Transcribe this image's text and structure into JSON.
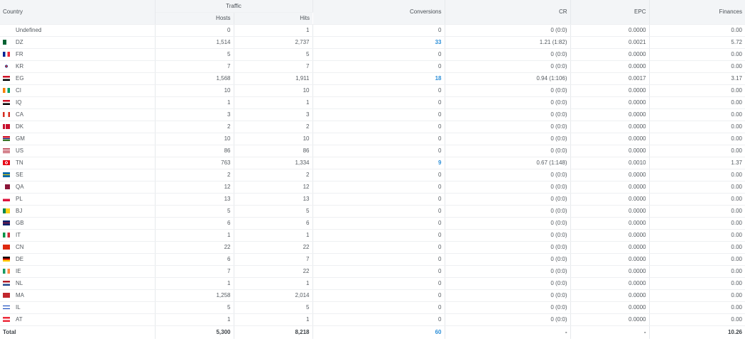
{
  "headers": {
    "country": "Country",
    "traffic": "Traffic",
    "hosts": "Hosts",
    "hits": "Hits",
    "conversions": "Conversions",
    "cr": "CR",
    "epc": "EPC",
    "finances": "Finances"
  },
  "rows": [
    {
      "country": "Undefined",
      "flag": "none",
      "hosts": "0",
      "hits": "1",
      "conversions": "0",
      "conv_link": false,
      "cr": "0 (0:0)",
      "epc": "0.0000",
      "finances": "0.00"
    },
    {
      "country": "DZ",
      "flag": "dz",
      "hosts": "1,514",
      "hits": "2,737",
      "conversions": "33",
      "conv_link": true,
      "cr": "1.21 (1:82)",
      "epc": "0.0021",
      "finances": "5.72"
    },
    {
      "country": "FR",
      "flag": "fr",
      "hosts": "5",
      "hits": "5",
      "conversions": "0",
      "conv_link": false,
      "cr": "0 (0:0)",
      "epc": "0.0000",
      "finances": "0.00"
    },
    {
      "country": "KR",
      "flag": "kr",
      "hosts": "7",
      "hits": "7",
      "conversions": "0",
      "conv_link": false,
      "cr": "0 (0:0)",
      "epc": "0.0000",
      "finances": "0.00"
    },
    {
      "country": "EG",
      "flag": "eg",
      "hosts": "1,568",
      "hits": "1,911",
      "conversions": "18",
      "conv_link": true,
      "cr": "0.94 (1:106)",
      "epc": "0.0017",
      "finances": "3.17"
    },
    {
      "country": "CI",
      "flag": "ci",
      "hosts": "10",
      "hits": "10",
      "conversions": "0",
      "conv_link": false,
      "cr": "0 (0:0)",
      "epc": "0.0000",
      "finances": "0.00"
    },
    {
      "country": "IQ",
      "flag": "iq",
      "hosts": "1",
      "hits": "1",
      "conversions": "0",
      "conv_link": false,
      "cr": "0 (0:0)",
      "epc": "0.0000",
      "finances": "0.00"
    },
    {
      "country": "CA",
      "flag": "ca",
      "hosts": "3",
      "hits": "3",
      "conversions": "0",
      "conv_link": false,
      "cr": "0 (0:0)",
      "epc": "0.0000",
      "finances": "0.00"
    },
    {
      "country": "DK",
      "flag": "dk",
      "hosts": "2",
      "hits": "2",
      "conversions": "0",
      "conv_link": false,
      "cr": "0 (0:0)",
      "epc": "0.0000",
      "finances": "0.00"
    },
    {
      "country": "GM",
      "flag": "gm",
      "hosts": "10",
      "hits": "10",
      "conversions": "0",
      "conv_link": false,
      "cr": "0 (0:0)",
      "epc": "0.0000",
      "finances": "0.00"
    },
    {
      "country": "US",
      "flag": "us",
      "hosts": "86",
      "hits": "86",
      "conversions": "0",
      "conv_link": false,
      "cr": "0 (0:0)",
      "epc": "0.0000",
      "finances": "0.00"
    },
    {
      "country": "TN",
      "flag": "tn",
      "hosts": "763",
      "hits": "1,334",
      "conversions": "9",
      "conv_link": true,
      "cr": "0.67 (1:148)",
      "epc": "0.0010",
      "finances": "1.37"
    },
    {
      "country": "SE",
      "flag": "se",
      "hosts": "2",
      "hits": "2",
      "conversions": "0",
      "conv_link": false,
      "cr": "0 (0:0)",
      "epc": "0.0000",
      "finances": "0.00"
    },
    {
      "country": "QA",
      "flag": "qa",
      "hosts": "12",
      "hits": "12",
      "conversions": "0",
      "conv_link": false,
      "cr": "0 (0:0)",
      "epc": "0.0000",
      "finances": "0.00"
    },
    {
      "country": "PL",
      "flag": "pl",
      "hosts": "13",
      "hits": "13",
      "conversions": "0",
      "conv_link": false,
      "cr": "0 (0:0)",
      "epc": "0.0000",
      "finances": "0.00"
    },
    {
      "country": "BJ",
      "flag": "bj",
      "hosts": "5",
      "hits": "5",
      "conversions": "0",
      "conv_link": false,
      "cr": "0 (0:0)",
      "epc": "0.0000",
      "finances": "0.00"
    },
    {
      "country": "GB",
      "flag": "gb",
      "hosts": "6",
      "hits": "6",
      "conversions": "0",
      "conv_link": false,
      "cr": "0 (0:0)",
      "epc": "0.0000",
      "finances": "0.00"
    },
    {
      "country": "IT",
      "flag": "it",
      "hosts": "1",
      "hits": "1",
      "conversions": "0",
      "conv_link": false,
      "cr": "0 (0:0)",
      "epc": "0.0000",
      "finances": "0.00"
    },
    {
      "country": "CN",
      "flag": "cn",
      "hosts": "22",
      "hits": "22",
      "conversions": "0",
      "conv_link": false,
      "cr": "0 (0:0)",
      "epc": "0.0000",
      "finances": "0.00"
    },
    {
      "country": "DE",
      "flag": "de",
      "hosts": "6",
      "hits": "7",
      "conversions": "0",
      "conv_link": false,
      "cr": "0 (0:0)",
      "epc": "0.0000",
      "finances": "0.00"
    },
    {
      "country": "IE",
      "flag": "ie",
      "hosts": "7",
      "hits": "22",
      "conversions": "0",
      "conv_link": false,
      "cr": "0 (0:0)",
      "epc": "0.0000",
      "finances": "0.00"
    },
    {
      "country": "NL",
      "flag": "nl",
      "hosts": "1",
      "hits": "1",
      "conversions": "0",
      "conv_link": false,
      "cr": "0 (0:0)",
      "epc": "0.0000",
      "finances": "0.00"
    },
    {
      "country": "MA",
      "flag": "ma",
      "hosts": "1,258",
      "hits": "2,014",
      "conversions": "0",
      "conv_link": false,
      "cr": "0 (0:0)",
      "epc": "0.0000",
      "finances": "0.00"
    },
    {
      "country": "IL",
      "flag": "il",
      "hosts": "5",
      "hits": "5",
      "conversions": "0",
      "conv_link": false,
      "cr": "0 (0:0)",
      "epc": "0.0000",
      "finances": "0.00"
    },
    {
      "country": "AT",
      "flag": "at",
      "hosts": "1",
      "hits": "1",
      "conversions": "0",
      "conv_link": false,
      "cr": "0 (0:0)",
      "epc": "0.0000",
      "finances": "0.00"
    }
  ],
  "total": {
    "label": "Total",
    "hosts": "5,300",
    "hits": "8,218",
    "conversions": "60",
    "cr": "-",
    "epc": "-",
    "finances": "10.26"
  },
  "colors": {
    "link": "#2d8fd8",
    "header_bg": "#f3f5f7",
    "text": "#555b61"
  },
  "flags": {
    "dz": "linear-gradient(to right,#006233 50%,#ffffff 50%)",
    "fr": "linear-gradient(to right,#002395 33%,#ffffff 33% 66%,#ed2939 66%)",
    "kr": "radial-gradient(circle at 50% 50%,#cd2e3a 0 22%,#0047a0 22% 34%,#ffffff 34%)",
    "eg": "linear-gradient(to bottom,#ce1126 33%,#ffffff 33% 66%,#000000 66%)",
    "ci": "linear-gradient(to right,#f77f00 33%,#ffffff 33% 66%,#009e60 66%)",
    "iq": "linear-gradient(to bottom,#ce1126 33%,#ffffff 33% 66%,#000000 66%)",
    "ca": "linear-gradient(to right,#d52b1e 25%,#ffffff 25% 75%,#d52b1e 75%)",
    "dk": "linear-gradient(to right,#c8102e 30%,#ffffff 30% 42%,#c8102e 42%)",
    "gm": "linear-gradient(to bottom,#ce1126 33%,#ffffff 33% 40%,#0c1c8c 40% 60%,#ffffff 60% 66%,#3a7728 66%)",
    "us": "linear-gradient(to bottom,#b22234 14%,#ffffff 14% 28%,#b22234 28% 42%,#ffffff 42% 57%,#b22234 57% 71%,#ffffff 71% 85%,#b22234 85%)",
    "tn": "radial-gradient(circle at 50% 50%,#e70013 0 15%,#ffffff 15% 32%,#e70013 32%)",
    "se": "linear-gradient(to bottom,#006aa7 40%,#fecc00 40% 60%,#006aa7 60%)",
    "qa": "linear-gradient(to right,#ffffff 30%,#8a1538 30%)",
    "pl": "linear-gradient(to bottom,#ffffff 50%,#dc143c 50%)",
    "bj": "linear-gradient(to right,#008751 40%,#fcd116 40%)",
    "gb": "linear-gradient(to bottom,#012169 40%,#ffffff 40% 45%,#c8102e 45% 55%,#ffffff 55% 60%,#012169 60%)",
    "it": "linear-gradient(to right,#009246 33%,#ffffff 33% 66%,#ce2b37 66%)",
    "cn": "linear-gradient(to right,#de2910 100%,#de2910 100%)",
    "de": "linear-gradient(to bottom,#000000 33%,#dd0000 33% 66%,#ffce00 66%)",
    "ie": "linear-gradient(to right,#169b62 33%,#ffffff 33% 66%,#ff883e 66%)",
    "nl": "linear-gradient(to bottom,#ae1c28 33%,#ffffff 33% 66%,#21468b 66%)",
    "ma": "linear-gradient(to right,#c1272d 100%,#c1272d 100%)",
    "il": "linear-gradient(to bottom,#ffffff 15%,#0038b8 15% 28%,#ffffff 28% 72%,#0038b8 72% 85%,#ffffff 85%)",
    "at": "linear-gradient(to bottom,#ed2939 33%,#ffffff 33% 66%,#ed2939 66%)",
    "none": "transparent"
  }
}
